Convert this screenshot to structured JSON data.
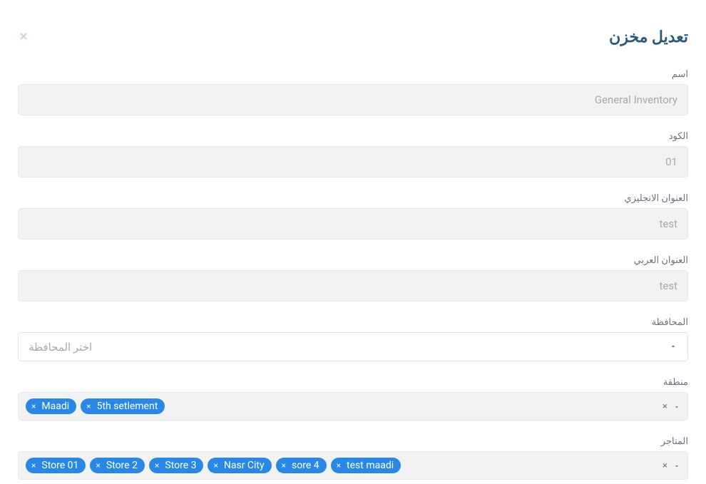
{
  "modal": {
    "title": "تعديل مخزن"
  },
  "fields": {
    "name": {
      "label": "اسم",
      "value": "General Inventory"
    },
    "code": {
      "label": "الكود",
      "value": "01"
    },
    "address_en": {
      "label": "العنوان الانجليزي",
      "value": "test"
    },
    "address_ar": {
      "label": "العنوان العربي",
      "value": "test"
    },
    "governorate": {
      "label": "المحافظة",
      "placeholder": "اختر المحافظة"
    },
    "zone": {
      "label": "منطقة",
      "tags": [
        {
          "label": "Maadi"
        },
        {
          "label": "5th setlement"
        }
      ]
    },
    "stores": {
      "label": "المتاجر",
      "tags": [
        {
          "label": "Store 01"
        },
        {
          "label": "Store 2"
        },
        {
          "label": "Store 3"
        },
        {
          "label": "Nasr City"
        },
        {
          "label": "sore 4"
        },
        {
          "label": "test maadi"
        }
      ]
    }
  }
}
